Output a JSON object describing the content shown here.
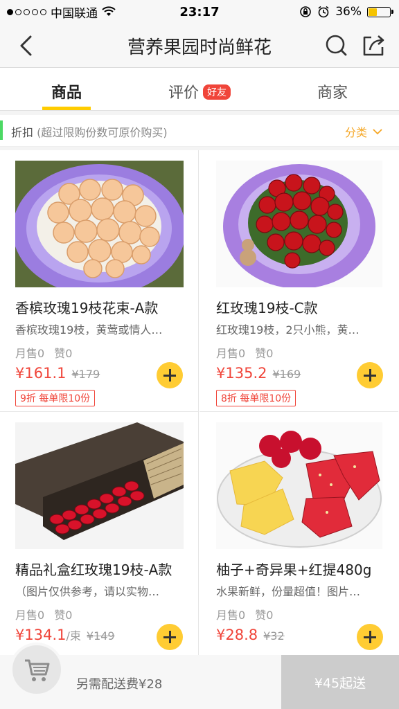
{
  "status": {
    "carrier": "中国联通",
    "time": "23:17",
    "battery_percent": "36%",
    "battery_level": 0.36
  },
  "nav": {
    "title": "营养果园时尚鲜花",
    "icons": [
      "back-arrow-icon",
      "search-icon",
      "share-icon"
    ]
  },
  "tabs": [
    {
      "label": "商品",
      "active": true
    },
    {
      "label": "评价",
      "badge": "好友"
    },
    {
      "label": "商家"
    }
  ],
  "filter": {
    "label": "折扣",
    "sub": "(超过限购份数可原价购买)",
    "category": "分类"
  },
  "products": [
    {
      "name": "香槟玫瑰19枝花束-A款",
      "desc": "香槟玫瑰19枝，黄莺或情人…",
      "sold": "月售0",
      "likes": "赞0",
      "price": "¥161.1",
      "unit": "",
      "old_price": "¥179",
      "discount": "9折 每单限10份"
    },
    {
      "name": "红玫瑰19枝-C款",
      "desc": "红玫瑰19枝，2只小熊，黄…",
      "sold": "月售0",
      "likes": "赞0",
      "price": "¥135.2",
      "unit": "",
      "old_price": "¥169",
      "discount": "8折 每单限10份"
    },
    {
      "name": "精品礼盒红玫瑰19枝-A款",
      "desc": "（图片仅供参考，请以实物…",
      "sold": "月售0",
      "likes": "赞0",
      "price": "¥134.1",
      "unit": "/束",
      "old_price": "¥149",
      "discount": ""
    },
    {
      "name": "柚子+奇异果+红提480g",
      "desc": "水果新鲜，份量超值！图片…",
      "sold": "月售0",
      "likes": "赞0",
      "price": "¥28.8",
      "unit": "",
      "old_price": "¥32",
      "discount": ""
    }
  ],
  "footer": {
    "delivery_fee": "另需配送费¥28",
    "min_order": "¥45起送"
  },
  "colors": {
    "accent": "#ffcc00",
    "price": "#f0453a",
    "category": "#f5a623",
    "indicator": "#4cd964"
  }
}
